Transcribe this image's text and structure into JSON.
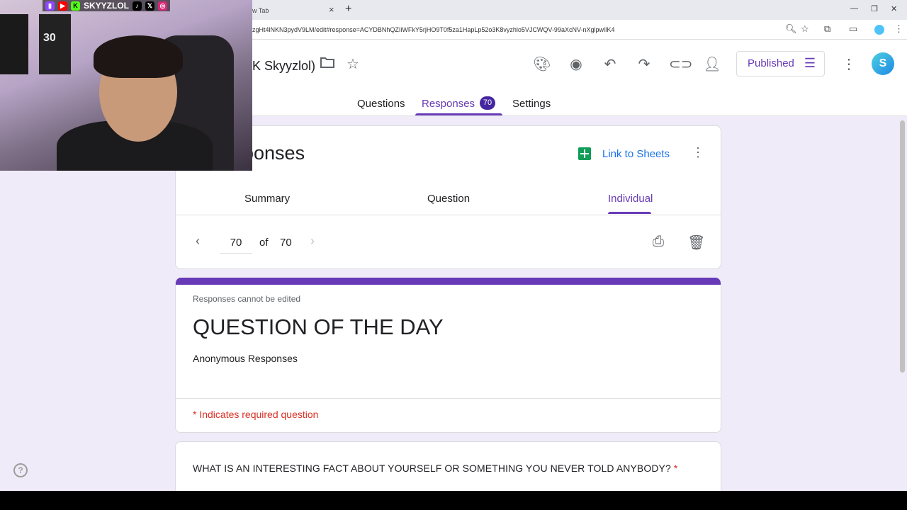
{
  "browser": {
    "tab_title": "w Tab",
    "url": "zgHt4lNKN3pydV9LM/edit#response=ACYDBNhQZIiWFkY5rjHO9T0f5za1HapLp52o3K8vyzhlo5VJCWQV-99aXcNV-nXglpwlIK4"
  },
  "header": {
    "doc_title": "K Skyyzlol)",
    "published_label": "Published",
    "tabs": [
      {
        "label": "Questions"
      },
      {
        "label": "Responses",
        "count": "70"
      },
      {
        "label": "Settings"
      }
    ]
  },
  "responses_card": {
    "title": "ponses",
    "link_sheets": "Link to Sheets",
    "sub_tabs": [
      "Summary",
      "Question",
      "Individual"
    ],
    "current": "70",
    "of_label": "of",
    "total": "70"
  },
  "form": {
    "notice": "Responses cannot be edited",
    "title": "QUESTION OF THE DAY",
    "description": "Anonymous Responses",
    "required_note": "* Indicates required question",
    "question": "WHAT IS AN INTERESTING FACT ABOUT YOURSELF OR SOMETHING YOU NEVER TOLD ANYBODY?",
    "required_mark": "*"
  },
  "webcam": {
    "handle": "SKYYZLOL",
    "jersey_number": "30"
  },
  "colors": {
    "accent": "#673ab7",
    "link": "#1a73e8",
    "required": "#d93025",
    "background": "#f0ebf8"
  }
}
